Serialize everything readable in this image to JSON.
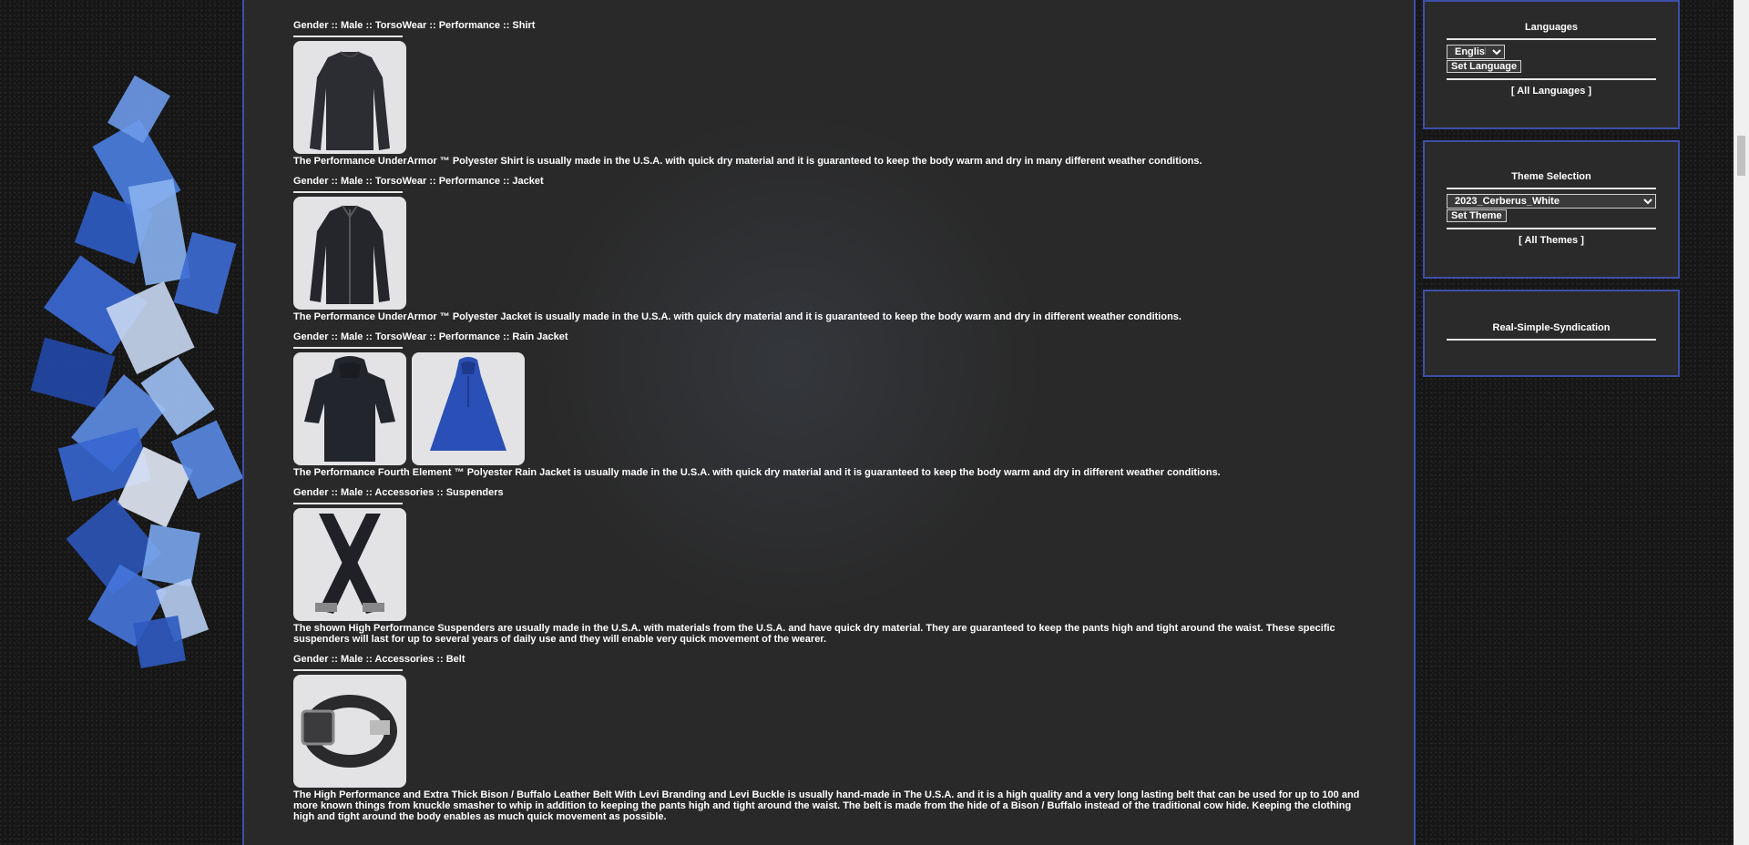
{
  "products": [
    {
      "category": "Gender :: Male :: TorsoWear :: Performance :: Shirt",
      "images": [
        "shirt"
      ],
      "description": "The Performance UnderArmor ™ Polyester Shirt is usually made in the U.S.A. with quick dry material and it is guaranteed to keep the body warm and dry in many different weather conditions."
    },
    {
      "category": "Gender :: Male :: TorsoWear :: Performance :: Jacket",
      "images": [
        "jacket"
      ],
      "description": "The Performance UnderArmor ™ Polyester Jacket is usually made in the U.S.A. with quick dry material and it is guaranteed to keep the body warm and dry in different weather conditions."
    },
    {
      "category": "Gender :: Male :: TorsoWear :: Performance :: Rain Jacket",
      "images": [
        "rain-jacket",
        "rain-poncho"
      ],
      "description": "The Performance Fourth Element ™ Polyester Rain Jacket is usually made in the U.S.A. with quick dry material and it is guaranteed to keep the body warm and dry in different weather conditions."
    },
    {
      "category": "Gender :: Male :: Accessories :: Suspenders",
      "images": [
        "suspenders"
      ],
      "description": "The shown High Performance Suspenders are usually made in the U.S.A. with materials from the U.S.A. and have quick dry material. They are guaranteed to keep the pants high and tight around the waist. These specific suspenders will last for up to several years of daily use and they will enable very quick movement of the wearer."
    },
    {
      "category": "Gender :: Male :: Accessories :: Belt",
      "images": [
        "belt"
      ],
      "description": "The High Performance and Extra Thick Bison / Buffalo Leather Belt With Levi Branding and Levi Buckle is usually hand-made in The U.S.A. and it is a high quality and a very long lasting belt that can be used for up to 100 and more known things from knuckle smasher to whip in addition to keeping the pants high and tight around the waist. The belt is made from the hide of a Bison / Buffalo instead of the traditional cow hide. Keeping the clothing high and tight around the body enables as much quick movement as possible."
    }
  ],
  "sidebar": {
    "languages": {
      "title": "Languages",
      "selected": "English",
      "button": "Set Language",
      "link": "[ All Languages ]"
    },
    "themes": {
      "title": "Theme Selection",
      "selected": "2023_Cerberus_White",
      "button": "Set Theme",
      "link": "[ All Themes ]"
    },
    "rss": {
      "title": "Real-Simple-Syndication"
    }
  },
  "colors": {
    "accent": "#3d4ea8",
    "panel": "#292929",
    "background": "#161616"
  }
}
